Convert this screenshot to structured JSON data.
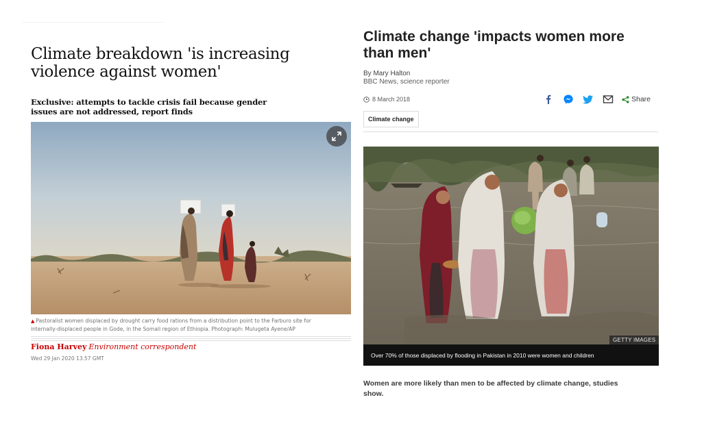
{
  "guardian": {
    "headline": "Climate breakdown 'is increasing violence against women'",
    "standfirst": "Exclusive: attempts to tackle crisis fail because gender issues are not addressed, report finds",
    "caption_marker": "▲",
    "caption": "Pastoralist women displaced by drought carry food rations from a distribution point to the Farburo site for internally-displaced people in Gode, in the Somali region of Ethiopia. Photograph: Mulugeta Ayene/AP",
    "author": "Fiona Harvey",
    "role": "Environment correspondent",
    "date": "Wed 29 Jan 2020 13.57 GMT",
    "icons": {
      "expand": "expand-icon",
      "caption_marker": "caption-triangle-icon"
    },
    "colors": {
      "accent": "#c70000",
      "text": "#121212",
      "muted": "#707070"
    }
  },
  "bbc": {
    "headline": "Climate change 'impacts women more than men'",
    "author": "By Mary Halton",
    "organisation": "BBC News, science reporter",
    "date": "8 March 2018",
    "share_label": "Share",
    "tag": "Climate change",
    "image_credit": "GETTY IMAGES",
    "image_caption": "Over 70% of those displaced by flooding in Pakistan in 2010 were women and children",
    "intro": "Women are more likely than men to be affected by climate change, studies show.",
    "icons": {
      "clock": "clock-icon",
      "facebook": "facebook-icon",
      "messenger": "messenger-icon",
      "twitter": "twitter-icon",
      "email": "email-icon",
      "share": "share-icon"
    },
    "colors": {
      "facebook": "#3b5998",
      "messenger": "#0084ff",
      "twitter": "#1da1f2",
      "share": "#2a8a2a"
    }
  }
}
